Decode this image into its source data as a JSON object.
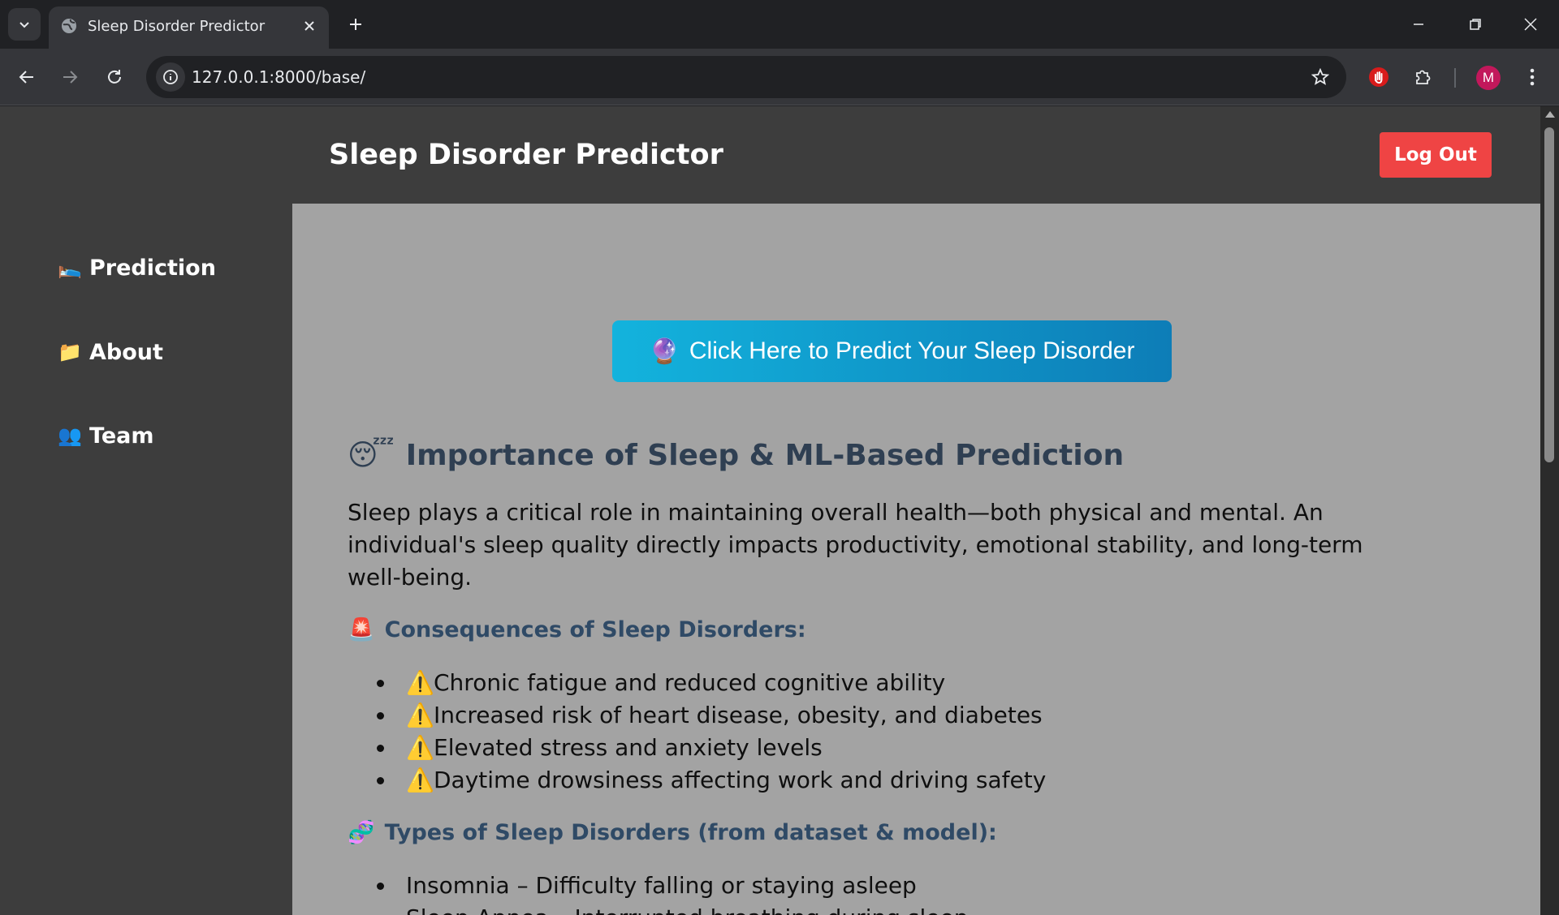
{
  "browser": {
    "tab_title": "Sleep Disorder Predictor",
    "url": "127.0.0.1:8000/base/",
    "profile_initial": "M"
  },
  "icons": {
    "tab_list": "chevron-down-icon",
    "favicon": "globe-icon",
    "tab_close": "close-icon",
    "new_tab": "plus-icon",
    "back": "arrow-left-icon",
    "forward": "arrow-right-icon",
    "reload": "reload-icon",
    "site_info": "info-icon",
    "bookmark": "star-icon",
    "extension_red": "hand-stop-icon",
    "extensions": "puzzle-icon",
    "menu": "kebab-menu-icon"
  },
  "sidebar": {
    "items": [
      {
        "emoji": "🛌",
        "label": "Prediction"
      },
      {
        "emoji": "📁",
        "label": "About"
      },
      {
        "emoji": "👥",
        "label": "Team"
      }
    ]
  },
  "header": {
    "title": "Sleep Disorder Predictor",
    "logout_label": "Log Out"
  },
  "main": {
    "predict_button": {
      "emoji": "🔮",
      "label": "Click Here to Predict Your Sleep Disorder"
    },
    "heading": {
      "emoji": "😴",
      "text": "Importance of Sleep & ML-Based Prediction"
    },
    "intro": "Sleep plays a critical role in maintaining overall health—both physical and mental. An individual's sleep quality directly impacts productivity, emotional stability, and long-term well-being.",
    "consequences": {
      "emoji": "🚨",
      "title": "Consequences of Sleep Disorders:",
      "warn_emoji": "⚠️",
      "items": [
        "Chronic fatigue and reduced cognitive ability",
        "Increased risk of heart disease, obesity, and diabetes",
        "Elevated stress and anxiety levels",
        "Daytime drowsiness affecting work and driving safety"
      ]
    },
    "types": {
      "emoji": "🧬",
      "title": "Types of Sleep Disorders (from dataset & model):",
      "items": [
        "Insomnia – Difficulty falling or staying asleep",
        "Sleep Apnea – Interrupted breathing during sleep"
      ]
    }
  },
  "colors": {
    "page_bg": "#3d3d3d",
    "content_bg": "#a3a3a3",
    "logout": "#ef4444",
    "predict_start": "#13b3dd",
    "predict_end": "#0d7db7",
    "heading": "#2f3f52"
  }
}
